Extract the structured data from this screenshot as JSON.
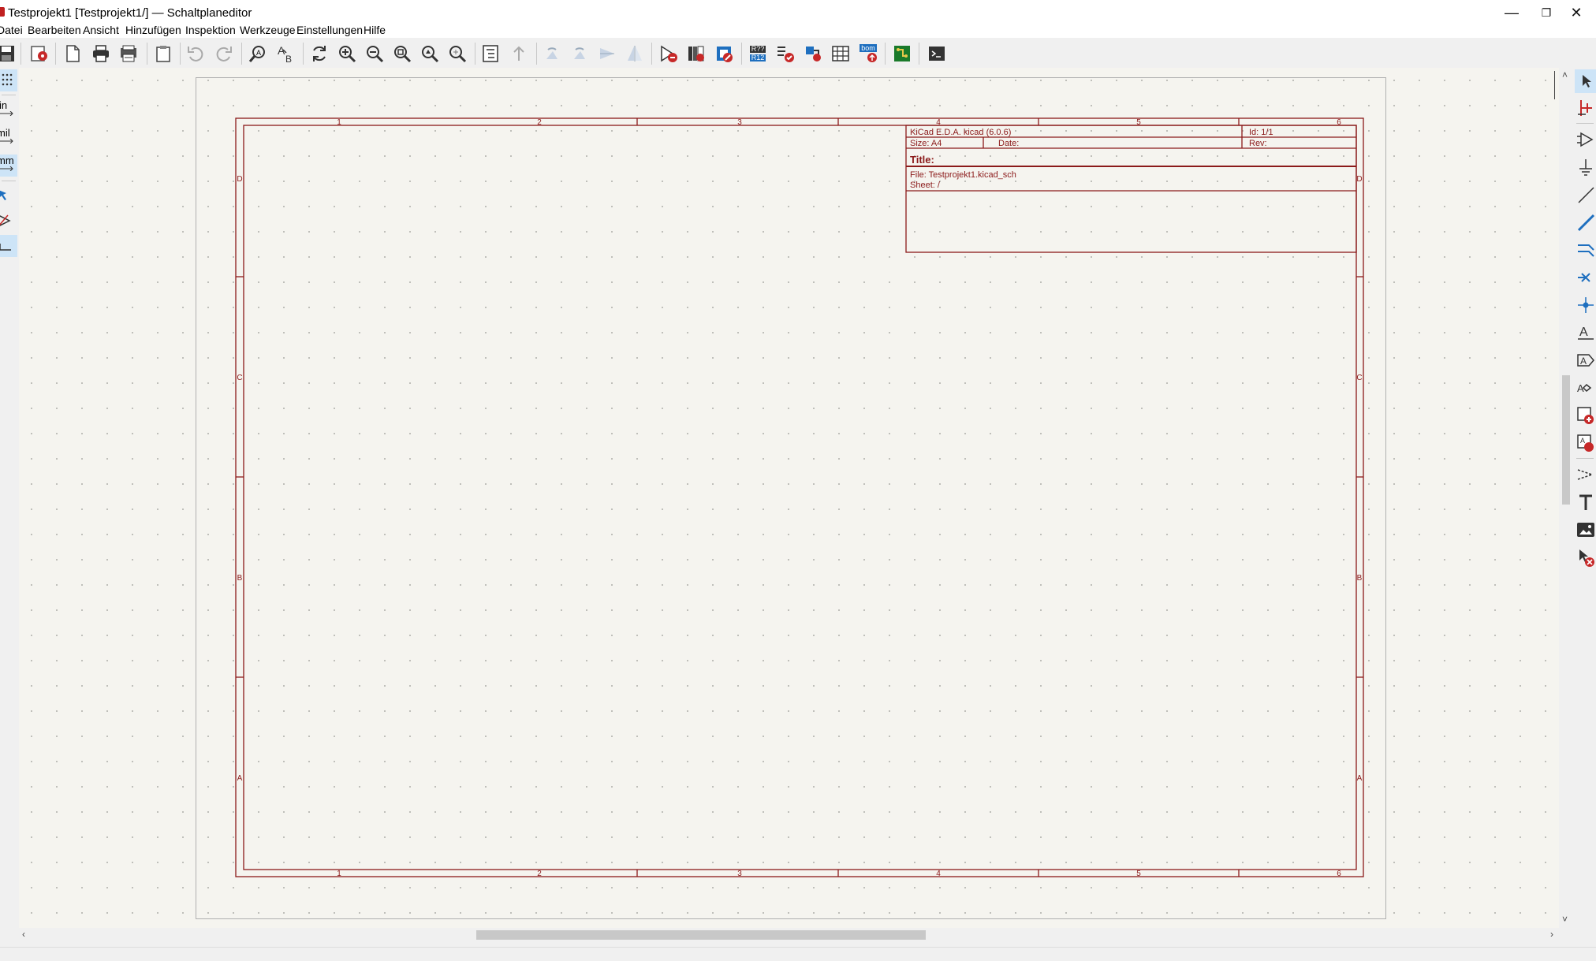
{
  "window": {
    "title": "Testprojekt1 [Testprojekt1/] — Schaltplaneditor",
    "minimize": "—",
    "restore": "❐",
    "close": "✕"
  },
  "menu": [
    "Datei",
    "Bearbeiten",
    "Ansicht",
    "Hinzufügen",
    "Inspektion",
    "Werkzeuge",
    "Einstellungen",
    "Hilfe"
  ],
  "left_toolbar": {
    "units_in": "in",
    "units_mil": "mil",
    "units_mm": "mm"
  },
  "toolbar": {
    "annotate_badge_top": "R??",
    "annotate_badge_bottom": "R12",
    "bom_badge": "bom"
  },
  "sheet": {
    "col_labels": [
      "1",
      "2",
      "3",
      "4",
      "5",
      "6"
    ],
    "row_labels": [
      "D",
      "C",
      "B",
      "A"
    ],
    "title_block": {
      "kicad_version": "KiCad E.D.A.  kicad (6.0.6)",
      "id": "Id: 1/1",
      "size": "Size: A4",
      "date": "Date:",
      "rev": "Rev:",
      "title": "Title:",
      "file": "File: Testprojekt1.kicad_sch",
      "sheet": "Sheet: /"
    }
  },
  "colors": {
    "sheet_border": "#8b1a1a",
    "canvas_bg": "#f5f4ef",
    "active_tool_bg": "#cde4f7"
  }
}
